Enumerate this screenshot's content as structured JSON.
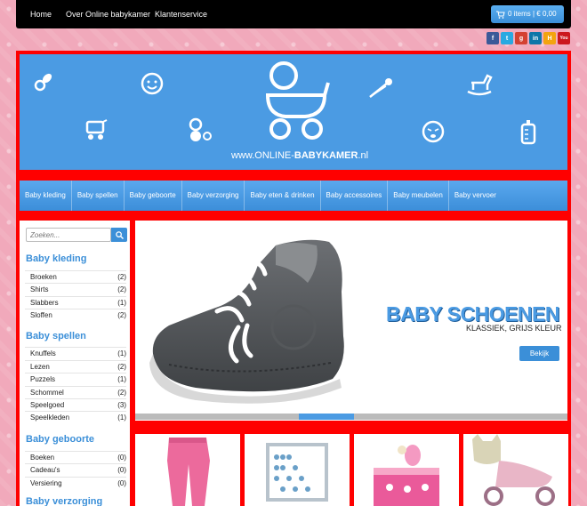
{
  "topbar": {
    "nav": [
      "Home",
      "Over Online babykamer",
      "Klantenservice"
    ],
    "cart_label": "0 items | € 0,00"
  },
  "social_icons": [
    "facebook-icon",
    "twitter-icon",
    "google-plus-icon",
    "linkedin-icon",
    "hyves-icon",
    "youtube-icon"
  ],
  "header": {
    "logo_text_prefix": "www.ONLINE-",
    "logo_text_bold": "BABYKAMER",
    "logo_text_suffix": ".nl"
  },
  "catnav": [
    "Baby kleding",
    "Baby spellen",
    "Baby geboorte",
    "Baby verzorging",
    "Baby eten & drinken",
    "Baby accessoires",
    "Baby meubelen",
    "Baby vervoer"
  ],
  "sidebar": {
    "search_placeholder": "Zoeken...",
    "categories": [
      {
        "title": "Baby kleding",
        "items": [
          {
            "label": "Broeken",
            "count": "(2)"
          },
          {
            "label": "Shirts",
            "count": "(2)"
          },
          {
            "label": "Slabbers",
            "count": "(1)"
          },
          {
            "label": "Sloffen",
            "count": "(2)"
          }
        ]
      },
      {
        "title": "Baby spellen",
        "items": [
          {
            "label": "Knuffels",
            "count": "(1)"
          },
          {
            "label": "Lezen",
            "count": "(2)"
          },
          {
            "label": "Puzzels",
            "count": "(1)"
          },
          {
            "label": "Schommel",
            "count": "(2)"
          },
          {
            "label": "Speelgoed",
            "count": "(3)"
          },
          {
            "label": "Speelkleden",
            "count": "(1)"
          }
        ]
      },
      {
        "title": "Baby geboorte",
        "items": [
          {
            "label": "Boeken",
            "count": "(0)"
          },
          {
            "label": "Cadeau's",
            "count": "(0)"
          },
          {
            "label": "Versiering",
            "count": "(0)"
          }
        ]
      },
      {
        "title": "Baby verzorging",
        "items": []
      }
    ]
  },
  "slider": {
    "title": "BABY SCHOENEN",
    "subtitle": "KLASSIEK, GRIJS KLEUR",
    "button": "Bekijk"
  },
  "colors": {
    "accent": "#4b9be3",
    "frame": "#ff0000",
    "background": "#f1a9bb"
  }
}
